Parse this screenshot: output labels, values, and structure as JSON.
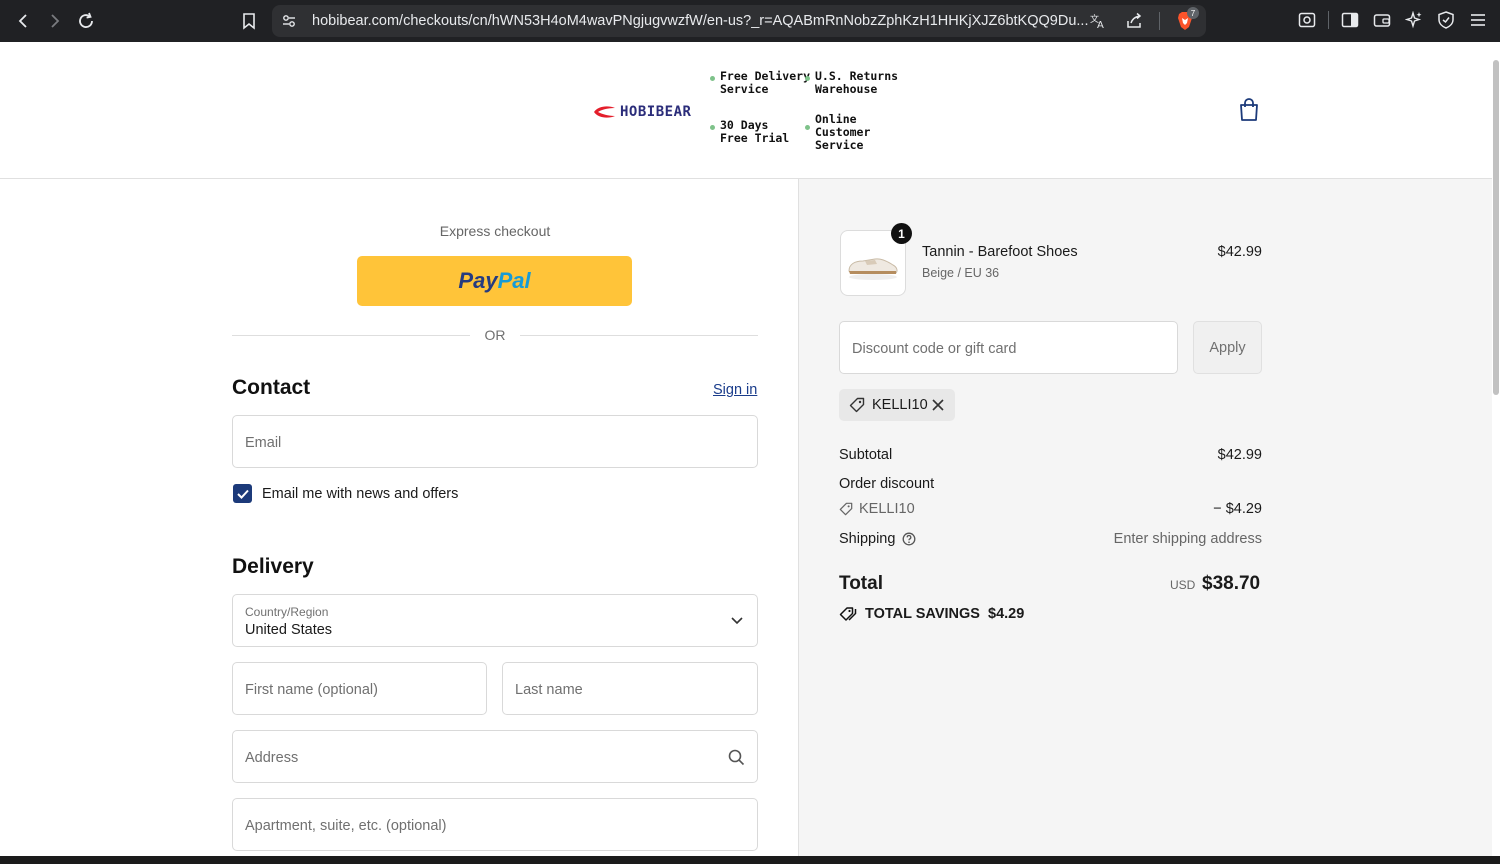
{
  "browser": {
    "url": "hobibear.com/checkouts/cn/hWN53H4oM4wavPNgjugvwzfW/en-us?_r=AQABmRnNobzZphKzH1HHKjXJZ6btKQQ9Du...",
    "brave_badge_count": "7",
    "icons": [
      "back-icon",
      "forward-icon",
      "reload-icon",
      "bookmark-icon",
      "site-settings-icon",
      "translate-icon",
      "share-icon",
      "brave-shields-icon",
      "screenshot-icon",
      "sidebar-icon",
      "wallet-icon",
      "leo-ai-icon",
      "vpn-icon",
      "menu-icon"
    ]
  },
  "header": {
    "logo_text": "HOBIBEAR",
    "features": {
      "free_delivery": [
        "Free Delivery",
        "Service"
      ],
      "returns": [
        "U.S. Returns",
        "Warehouse"
      ],
      "trial": [
        "30 Days",
        "Free Trial"
      ],
      "support": [
        "Online",
        "Customer",
        "Service"
      ]
    },
    "cart_icon": "shopping-bag-icon"
  },
  "checkout": {
    "express_label": "Express checkout",
    "paypal_label_1": "Pay",
    "paypal_label_2": "Pal",
    "or_label": "OR",
    "contact_title": "Contact",
    "sign_in": "Sign in",
    "email_placeholder": "Email",
    "email_opt_in_label": "Email me with news and offers",
    "email_opt_in_checked": true,
    "delivery_title": "Delivery",
    "country_label": "Country/Region",
    "country_value": "United States",
    "first_name_placeholder": "First name (optional)",
    "last_name_placeholder": "Last name",
    "address_placeholder": "Address",
    "apartment_placeholder": "Apartment, suite, etc. (optional)"
  },
  "summary": {
    "product": {
      "quantity": "1",
      "name": "Tannin - Barefoot Shoes",
      "variant": "Beige / EU 36",
      "price": "$42.99"
    },
    "discount_placeholder": "Discount code or gift card",
    "apply_label": "Apply",
    "applied_code": "KELLI10",
    "subtotal_label": "Subtotal",
    "subtotal_value": "$42.99",
    "order_discount_label": "Order discount",
    "discount_code": "KELLI10",
    "discount_value": "− $4.29",
    "shipping_label": "Shipping",
    "shipping_value": "Enter shipping address",
    "total_label": "Total",
    "currency": "USD",
    "total_value": "$38.70",
    "savings_label": "TOTAL SAVINGS",
    "savings_value": "$4.29"
  },
  "colors": {
    "paypal_yellow": "#ffc439",
    "checkbox_blue": "#1c3a7a",
    "link_blue": "#1a3c8b",
    "summary_bg": "#f5f5f5"
  }
}
